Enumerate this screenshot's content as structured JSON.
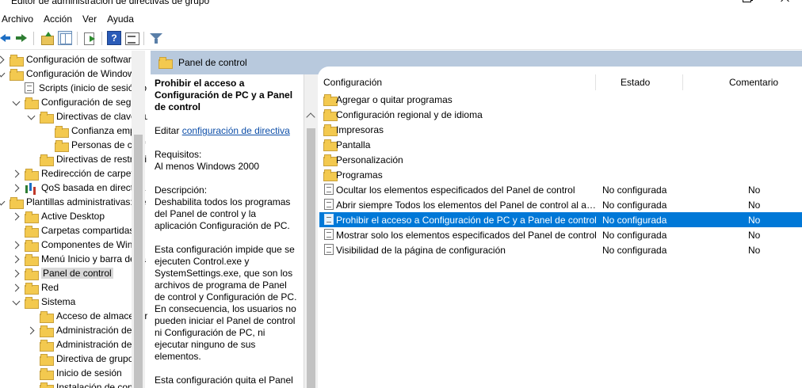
{
  "window": {
    "title": "Editor de administración de directivas de grupo"
  },
  "menu": [
    "Archivo",
    "Acción",
    "Ver",
    "Ayuda"
  ],
  "toolbar": {
    "help_label": "?"
  },
  "tree": [
    {
      "label": "Configuración de software",
      "indent": 0,
      "toggle": "closed",
      "icon": "folder"
    },
    {
      "label": "Configuración de Windows",
      "indent": 0,
      "toggle": "open",
      "icon": "folder"
    },
    {
      "label": "Scripts (inicio de sesión o",
      "indent": 1,
      "toggle": "none",
      "icon": "doc"
    },
    {
      "label": "Configuración de seguri",
      "indent": 1,
      "toggle": "open",
      "icon": "folder"
    },
    {
      "label": "Directivas de clave pu",
      "indent": 2,
      "toggle": "open",
      "icon": "folder"
    },
    {
      "label": "Confianza empre",
      "indent": 3,
      "toggle": "none",
      "icon": "folder"
    },
    {
      "label": "Personas de conf",
      "indent": 3,
      "toggle": "none",
      "icon": "folder"
    },
    {
      "label": "Directivas de restricci",
      "indent": 2,
      "toggle": "none",
      "icon": "folder"
    },
    {
      "label": "Redirección de carpetas",
      "indent": 1,
      "toggle": "closed",
      "icon": "folder"
    },
    {
      "label": "QoS basada en directiva",
      "indent": 1,
      "toggle": "closed",
      "icon": "qos"
    },
    {
      "label": "Plantillas administrativas: de",
      "indent": 0,
      "toggle": "open",
      "icon": "folder"
    },
    {
      "label": "Active Desktop",
      "indent": 1,
      "toggle": "closed",
      "icon": "folder"
    },
    {
      "label": "Carpetas compartidas",
      "indent": 1,
      "toggle": "none",
      "icon": "folder"
    },
    {
      "label": "Componentes de Windo",
      "indent": 1,
      "toggle": "closed",
      "icon": "folder"
    },
    {
      "label": "Menú Inicio y barra de ta",
      "indent": 1,
      "toggle": "closed",
      "icon": "folder"
    },
    {
      "label": "Panel de control",
      "indent": 1,
      "toggle": "closed",
      "icon": "folder",
      "selected": true
    },
    {
      "label": "Red",
      "indent": 1,
      "toggle": "closed",
      "icon": "folder"
    },
    {
      "label": "Sistema",
      "indent": 1,
      "toggle": "open",
      "icon": "folder"
    },
    {
      "label": "Acceso de almacenar",
      "indent": 2,
      "toggle": "none",
      "icon": "folder"
    },
    {
      "label": "Administración de co",
      "indent": 2,
      "toggle": "closed",
      "icon": "folder"
    },
    {
      "label": "Administración de er",
      "indent": 2,
      "toggle": "none",
      "icon": "folder"
    },
    {
      "label": "Directiva de grupo",
      "indent": 2,
      "toggle": "none",
      "icon": "folder"
    },
    {
      "label": "Inicio de sesión",
      "indent": 2,
      "toggle": "none",
      "icon": "folder"
    },
    {
      "label": "Instalación de contro",
      "indent": 2,
      "toggle": "none",
      "icon": "folder"
    }
  ],
  "right_header": {
    "title": "Panel de control"
  },
  "description": {
    "title": "Prohibir el acceso a Configuración de PC y a Panel de control",
    "edit_prefix": "Editar ",
    "edit_link": "configuración de directiva",
    "requirements_label": "Requisitos:",
    "requirements_value": "Al menos Windows 2000",
    "description_label": "Descripción:",
    "description_p1": "Deshabilita todos los programas del Panel de control y la aplicación Configuración de PC.",
    "description_p2": "Esta configuración impide que se ejecuten Control.exe y SystemSettings.exe, que son los archivos de programa de Panel de control y Configuración de PC. En consecuencia, los usuarios no pueden iniciar el Panel de control ni Configuración de PC, ni ejecutar ninguno de sus elementos.",
    "description_p3": "Esta configuración quita el Panel de control de:"
  },
  "list": {
    "columns": {
      "name": "Configuración",
      "state": "Estado",
      "comment": "Comentario"
    },
    "rows": [
      {
        "name": "Agregar o quitar programas",
        "state": "",
        "comment": "",
        "icon": "folder"
      },
      {
        "name": "Configuración regional y de idioma",
        "state": "",
        "comment": "",
        "icon": "folder"
      },
      {
        "name": "Impresoras",
        "state": "",
        "comment": "",
        "icon": "folder"
      },
      {
        "name": "Pantalla",
        "state": "",
        "comment": "",
        "icon": "folder"
      },
      {
        "name": "Personalización",
        "state": "",
        "comment": "",
        "icon": "folder"
      },
      {
        "name": "Programas",
        "state": "",
        "comment": "",
        "icon": "folder"
      },
      {
        "name": "Ocultar los elementos especificados del Panel de control",
        "state": "No configurada",
        "comment": "No",
        "icon": "setting"
      },
      {
        "name": "Abrir siempre Todos los elementos del Panel de control al ab...",
        "state": "No configurada",
        "comment": "No",
        "icon": "setting"
      },
      {
        "name": "Prohibir el acceso a Configuración de PC y a Panel de control",
        "state": "No configurada",
        "comment": "No",
        "icon": "setting",
        "selected": true
      },
      {
        "name": "Mostrar solo los elementos especificados del Panel de control",
        "state": "No configurada",
        "comment": "No",
        "icon": "setting"
      },
      {
        "name": "Visibilidad de la página de configuración",
        "state": "No configurada",
        "comment": "No",
        "icon": "setting"
      }
    ]
  }
}
